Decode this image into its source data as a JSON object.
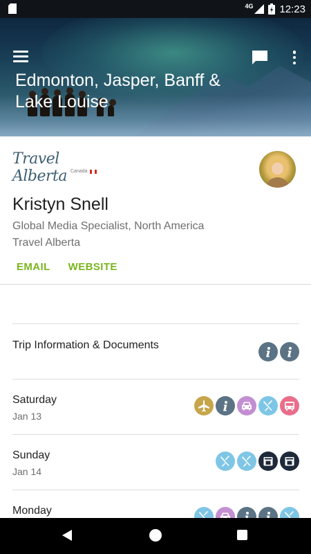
{
  "status_bar": {
    "network": "4G",
    "time": "12:23"
  },
  "header": {
    "title": "Edmonton, Jasper, Banff & Lake Louise",
    "menu_icon": "hamburger-menu-icon",
    "chat_icon": "chat-bubble-icon",
    "more_icon": "more-vert-icon"
  },
  "profile": {
    "logo_text": "Travel Alberta",
    "logo_subtext": "Canada",
    "name": "Kristyn Snell",
    "role_line1": "Global Media Specialist, North America",
    "role_line2": "Travel Alberta",
    "email_label": "EMAIL",
    "website_label": "WEBSITE",
    "accent_color": "#7ab51d"
  },
  "itinerary": [
    {
      "label": "Trip Information & Documents",
      "sub": "",
      "icons": [
        "info-icon",
        "info-icon"
      ]
    },
    {
      "label": "Saturday",
      "sub": "Jan 13",
      "icons": [
        "flight-icon",
        "info-icon",
        "car-icon",
        "restaurant-icon",
        "bus-icon"
      ]
    },
    {
      "label": "Sunday",
      "sub": "Jan 14",
      "icons": [
        "restaurant-icon",
        "restaurant-icon",
        "hotel-icon",
        "hotel-icon"
      ]
    },
    {
      "label": "Monday",
      "sub": "",
      "icons": [
        "restaurant-icon",
        "car-icon",
        "info-icon",
        "info-icon",
        "restaurant-icon"
      ]
    }
  ],
  "icon_colors": {
    "info-icon": "#5b7384",
    "flight-icon": "#c7a54a",
    "car-icon": "#c38fd3",
    "restaurant-icon": "#7fc6e6",
    "bus-icon": "#ea6e8c",
    "hotel-icon": "#1e2a3a"
  }
}
